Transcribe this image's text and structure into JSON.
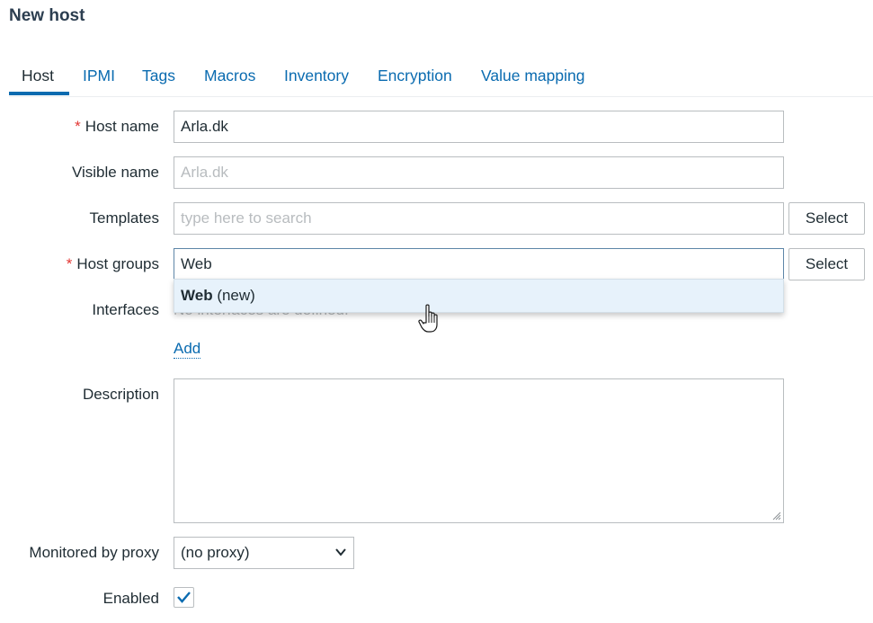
{
  "page": {
    "title": "New host"
  },
  "tabs": [
    {
      "label": "Host",
      "active": true
    },
    {
      "label": "IPMI"
    },
    {
      "label": "Tags"
    },
    {
      "label": "Macros"
    },
    {
      "label": "Inventory"
    },
    {
      "label": "Encryption"
    },
    {
      "label": "Value mapping"
    }
  ],
  "form": {
    "required_mark": "*",
    "host_name": {
      "label": "Host name",
      "value": "Arla.dk"
    },
    "visible_name": {
      "label": "Visible name",
      "placeholder": "Arla.dk"
    },
    "templates": {
      "label": "Templates",
      "placeholder": "type here to search",
      "button": "Select"
    },
    "host_groups": {
      "label": "Host groups",
      "value": "Web",
      "button": "Select",
      "suggestion": {
        "match": "Web",
        "suffix": "(new)"
      }
    },
    "interfaces": {
      "label": "Interfaces",
      "empty_text": "No interfaces are defined.",
      "add_link": "Add"
    },
    "description": {
      "label": "Description",
      "value": ""
    },
    "proxy": {
      "label": "Monitored by proxy",
      "value": "(no proxy)"
    },
    "enabled": {
      "label": "Enabled",
      "checked": true
    }
  },
  "colors": {
    "link": "#0a6bb0",
    "required": "#e33734",
    "dropdown_bg": "#e7f2fb"
  },
  "icons": {
    "cursor": "hand-pointer-icon",
    "select_arrow": "chevron-down-icon",
    "checkbox": "checkmark-icon"
  }
}
